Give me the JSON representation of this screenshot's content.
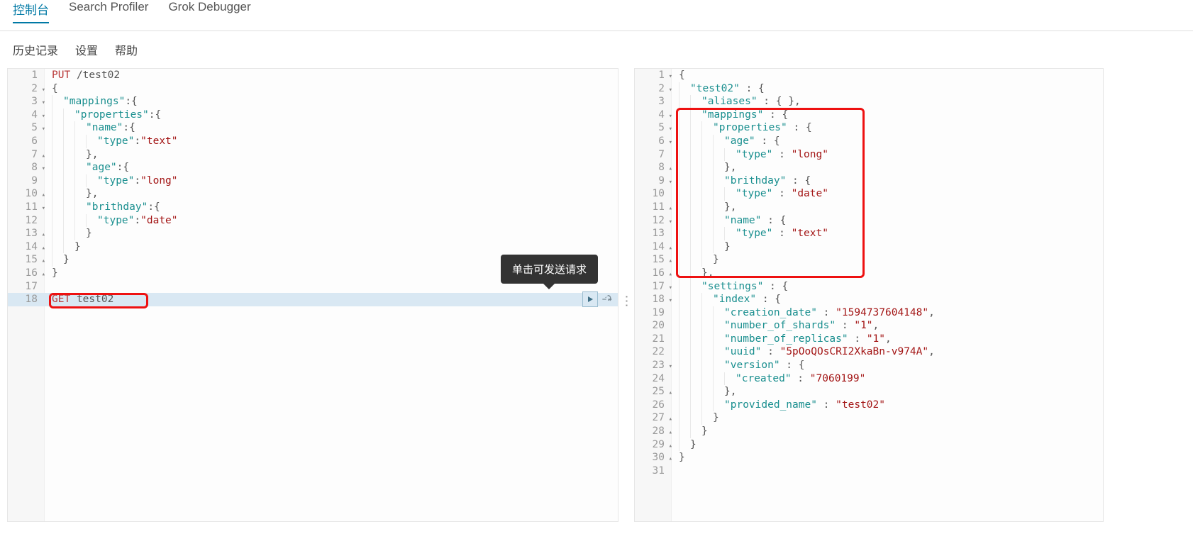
{
  "topTabs": {
    "active": "控制台",
    "t2": "Search Profiler",
    "t3": "Grok Debugger"
  },
  "subTabs": {
    "history": "历史记录",
    "settings": "设置",
    "help": "帮助"
  },
  "tooltip": "单击可发送请求",
  "leftEditor": {
    "lines": [
      {
        "n": 1,
        "fold": "",
        "tokens": [
          {
            "c": "tok-method",
            "t": "PUT"
          },
          {
            "c": "",
            "t": " "
          },
          {
            "c": "tok-path",
            "t": "/test02"
          }
        ]
      },
      {
        "n": 2,
        "fold": "▾",
        "tokens": [
          {
            "c": "tok-p",
            "t": "{"
          }
        ]
      },
      {
        "n": 3,
        "fold": "▾",
        "indent": 1,
        "tokens": [
          {
            "c": "tok-key",
            "t": "\"mappings\""
          },
          {
            "c": "tok-p",
            "t": ":{"
          }
        ]
      },
      {
        "n": 4,
        "fold": "▾",
        "indent": 2,
        "tokens": [
          {
            "c": "tok-key",
            "t": "\"properties\""
          },
          {
            "c": "tok-p",
            "t": ":{"
          }
        ]
      },
      {
        "n": 5,
        "fold": "▾",
        "indent": 3,
        "tokens": [
          {
            "c": "tok-key",
            "t": "\"name\""
          },
          {
            "c": "tok-p",
            "t": ":{"
          }
        ]
      },
      {
        "n": 6,
        "fold": "",
        "indent": 4,
        "tokens": [
          {
            "c": "tok-key",
            "t": "\"type\""
          },
          {
            "c": "tok-p",
            "t": ":"
          },
          {
            "c": "tok-str",
            "t": "\"text\""
          }
        ]
      },
      {
        "n": 7,
        "fold": "▴",
        "indent": 3,
        "tokens": [
          {
            "c": "tok-p",
            "t": "},"
          }
        ]
      },
      {
        "n": 8,
        "fold": "▾",
        "indent": 3,
        "tokens": [
          {
            "c": "tok-key",
            "t": "\"age\""
          },
          {
            "c": "tok-p",
            "t": ":{"
          }
        ]
      },
      {
        "n": 9,
        "fold": "",
        "indent": 4,
        "tokens": [
          {
            "c": "tok-key",
            "t": "\"type\""
          },
          {
            "c": "tok-p",
            "t": ":"
          },
          {
            "c": "tok-str",
            "t": "\"long\""
          }
        ]
      },
      {
        "n": 10,
        "fold": "▴",
        "indent": 3,
        "tokens": [
          {
            "c": "tok-p",
            "t": "},"
          }
        ]
      },
      {
        "n": 11,
        "fold": "▾",
        "indent": 3,
        "tokens": [
          {
            "c": "tok-key",
            "t": "\"brithday\""
          },
          {
            "c": "tok-p",
            "t": ":{"
          }
        ]
      },
      {
        "n": 12,
        "fold": "",
        "indent": 4,
        "tokens": [
          {
            "c": "tok-key",
            "t": "\"type\""
          },
          {
            "c": "tok-p",
            "t": ":"
          },
          {
            "c": "tok-str",
            "t": "\"date\""
          }
        ]
      },
      {
        "n": 13,
        "fold": "▴",
        "indent": 3,
        "tokens": [
          {
            "c": "tok-p",
            "t": "}"
          }
        ]
      },
      {
        "n": 14,
        "fold": "▴",
        "indent": 2,
        "tokens": [
          {
            "c": "tok-p",
            "t": "}"
          }
        ]
      },
      {
        "n": 15,
        "fold": "▴",
        "indent": 1,
        "tokens": [
          {
            "c": "tok-p",
            "t": "}"
          }
        ]
      },
      {
        "n": 16,
        "fold": "▴",
        "tokens": [
          {
            "c": "tok-p",
            "t": "}"
          }
        ]
      },
      {
        "n": 17,
        "fold": "",
        "tokens": []
      },
      {
        "n": 18,
        "fold": "",
        "hl": true,
        "tokens": [
          {
            "c": "tok-method",
            "t": "GET"
          },
          {
            "c": "",
            "t": " "
          },
          {
            "c": "tok-path",
            "t": "test02"
          }
        ]
      }
    ]
  },
  "rightEditor": {
    "lines": [
      {
        "n": 1,
        "fold": "▾",
        "tokens": [
          {
            "c": "tok-p",
            "t": "{"
          }
        ]
      },
      {
        "n": 2,
        "fold": "▾",
        "indent": 1,
        "tokens": [
          {
            "c": "tok-key",
            "t": "\"test02\""
          },
          {
            "c": "tok-p",
            "t": " : {"
          }
        ]
      },
      {
        "n": 3,
        "fold": "",
        "indent": 2,
        "tokens": [
          {
            "c": "tok-key",
            "t": "\"aliases\""
          },
          {
            "c": "tok-p",
            "t": " : { },"
          }
        ]
      },
      {
        "n": 4,
        "fold": "▾",
        "indent": 2,
        "tokens": [
          {
            "c": "tok-key",
            "t": "\"mappings\""
          },
          {
            "c": "tok-p",
            "t": " : {"
          }
        ]
      },
      {
        "n": 5,
        "fold": "▾",
        "indent": 3,
        "tokens": [
          {
            "c": "tok-key",
            "t": "\"properties\""
          },
          {
            "c": "tok-p",
            "t": " : {"
          }
        ]
      },
      {
        "n": 6,
        "fold": "▾",
        "indent": 4,
        "tokens": [
          {
            "c": "tok-key",
            "t": "\"age\""
          },
          {
            "c": "tok-p",
            "t": " : {"
          }
        ]
      },
      {
        "n": 7,
        "fold": "",
        "indent": 5,
        "tokens": [
          {
            "c": "tok-key",
            "t": "\"type\""
          },
          {
            "c": "tok-p",
            "t": " : "
          },
          {
            "c": "tok-str",
            "t": "\"long\""
          }
        ]
      },
      {
        "n": 8,
        "fold": "▴",
        "indent": 4,
        "tokens": [
          {
            "c": "tok-p",
            "t": "},"
          }
        ]
      },
      {
        "n": 9,
        "fold": "▾",
        "indent": 4,
        "tokens": [
          {
            "c": "tok-key",
            "t": "\"brithday\""
          },
          {
            "c": "tok-p",
            "t": " : {"
          }
        ]
      },
      {
        "n": 10,
        "fold": "",
        "indent": 5,
        "tokens": [
          {
            "c": "tok-key",
            "t": "\"type\""
          },
          {
            "c": "tok-p",
            "t": " : "
          },
          {
            "c": "tok-str",
            "t": "\"date\""
          }
        ]
      },
      {
        "n": 11,
        "fold": "▴",
        "indent": 4,
        "tokens": [
          {
            "c": "tok-p",
            "t": "},"
          }
        ]
      },
      {
        "n": 12,
        "fold": "▾",
        "indent": 4,
        "tokens": [
          {
            "c": "tok-key",
            "t": "\"name\""
          },
          {
            "c": "tok-p",
            "t": " : {"
          }
        ]
      },
      {
        "n": 13,
        "fold": "",
        "indent": 5,
        "tokens": [
          {
            "c": "tok-key",
            "t": "\"type\""
          },
          {
            "c": "tok-p",
            "t": " : "
          },
          {
            "c": "tok-str",
            "t": "\"text\""
          }
        ]
      },
      {
        "n": 14,
        "fold": "▴",
        "indent": 4,
        "tokens": [
          {
            "c": "tok-p",
            "t": "}"
          }
        ]
      },
      {
        "n": 15,
        "fold": "▴",
        "indent": 3,
        "tokens": [
          {
            "c": "tok-p",
            "t": "}"
          }
        ]
      },
      {
        "n": 16,
        "fold": "▴",
        "indent": 2,
        "tokens": [
          {
            "c": "tok-p",
            "t": "},"
          }
        ]
      },
      {
        "n": 17,
        "fold": "▾",
        "indent": 2,
        "tokens": [
          {
            "c": "tok-key",
            "t": "\"settings\""
          },
          {
            "c": "tok-p",
            "t": " : {"
          }
        ]
      },
      {
        "n": 18,
        "fold": "▾",
        "indent": 3,
        "tokens": [
          {
            "c": "tok-key",
            "t": "\"index\""
          },
          {
            "c": "tok-p",
            "t": " : {"
          }
        ]
      },
      {
        "n": 19,
        "fold": "",
        "indent": 4,
        "tokens": [
          {
            "c": "tok-key",
            "t": "\"creation_date\""
          },
          {
            "c": "tok-p",
            "t": " : "
          },
          {
            "c": "tok-str",
            "t": "\"1594737604148\""
          },
          {
            "c": "tok-p",
            "t": ","
          }
        ]
      },
      {
        "n": 20,
        "fold": "",
        "indent": 4,
        "tokens": [
          {
            "c": "tok-key",
            "t": "\"number_of_shards\""
          },
          {
            "c": "tok-p",
            "t": " : "
          },
          {
            "c": "tok-str",
            "t": "\"1\""
          },
          {
            "c": "tok-p",
            "t": ","
          }
        ]
      },
      {
        "n": 21,
        "fold": "",
        "indent": 4,
        "tokens": [
          {
            "c": "tok-key",
            "t": "\"number_of_replicas\""
          },
          {
            "c": "tok-p",
            "t": " : "
          },
          {
            "c": "tok-str",
            "t": "\"1\""
          },
          {
            "c": "tok-p",
            "t": ","
          }
        ]
      },
      {
        "n": 22,
        "fold": "",
        "indent": 4,
        "tokens": [
          {
            "c": "tok-key",
            "t": "\"uuid\""
          },
          {
            "c": "tok-p",
            "t": " : "
          },
          {
            "c": "tok-str",
            "t": "\"5pOoQOsCRI2XkaBn-v974A\""
          },
          {
            "c": "tok-p",
            "t": ","
          }
        ]
      },
      {
        "n": 23,
        "fold": "▾",
        "indent": 4,
        "tokens": [
          {
            "c": "tok-key",
            "t": "\"version\""
          },
          {
            "c": "tok-p",
            "t": " : {"
          }
        ]
      },
      {
        "n": 24,
        "fold": "",
        "indent": 5,
        "tokens": [
          {
            "c": "tok-key",
            "t": "\"created\""
          },
          {
            "c": "tok-p",
            "t": " : "
          },
          {
            "c": "tok-str",
            "t": "\"7060199\""
          }
        ]
      },
      {
        "n": 25,
        "fold": "▴",
        "indent": 4,
        "tokens": [
          {
            "c": "tok-p",
            "t": "},"
          }
        ]
      },
      {
        "n": 26,
        "fold": "",
        "indent": 4,
        "tokens": [
          {
            "c": "tok-key",
            "t": "\"provided_name\""
          },
          {
            "c": "tok-p",
            "t": " : "
          },
          {
            "c": "tok-str",
            "t": "\"test02\""
          }
        ]
      },
      {
        "n": 27,
        "fold": "▴",
        "indent": 3,
        "tokens": [
          {
            "c": "tok-p",
            "t": "}"
          }
        ]
      },
      {
        "n": 28,
        "fold": "▴",
        "indent": 2,
        "tokens": [
          {
            "c": "tok-p",
            "t": "}"
          }
        ]
      },
      {
        "n": 29,
        "fold": "▴",
        "indent": 1,
        "tokens": [
          {
            "c": "tok-p",
            "t": "}"
          }
        ]
      },
      {
        "n": 30,
        "fold": "▴",
        "tokens": [
          {
            "c": "tok-p",
            "t": "}"
          }
        ]
      },
      {
        "n": 31,
        "fold": "",
        "tokens": []
      }
    ]
  }
}
